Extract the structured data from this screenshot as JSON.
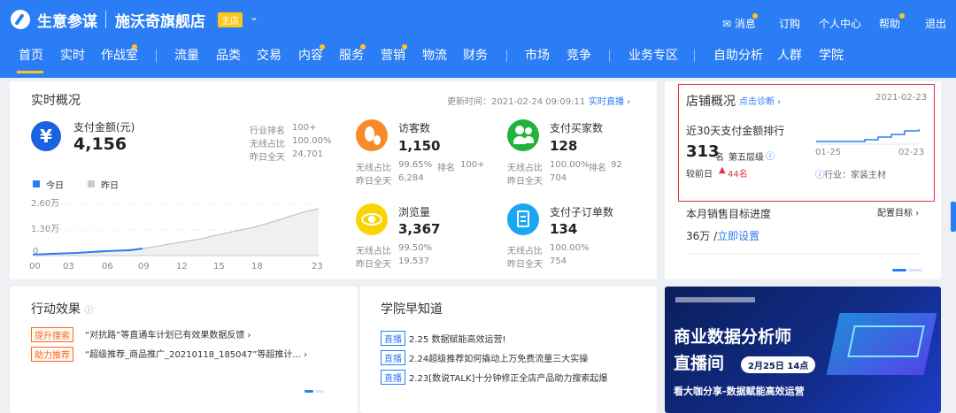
{
  "header": {
    "brand": "生意参谋",
    "shop_name": "施沃奇旗舰店",
    "shop_badge": "主店",
    "links": [
      "消息",
      "订购",
      "个人中心",
      "帮助",
      "退出"
    ]
  },
  "nav": [
    "首页",
    "实时",
    "作战室",
    "流量",
    "品类",
    "交易",
    "内容",
    "服务",
    "营销",
    "物流",
    "财务",
    "市场",
    "竞争",
    "业务专区",
    "自助分析",
    "人群",
    "学院"
  ],
  "realtime": {
    "title": "实时概况",
    "update_time": "更新时间：2021-02-24 09:09:11",
    "live_link": "实时直播",
    "pay": {
      "label": "支付金额(元)",
      "value": "4,156",
      "rank_label": "行业排名",
      "rank_value": "100+",
      "wireless_label": "无线占比",
      "wireless_value": "100.00%",
      "yesterday_label": "昨日全天",
      "yesterday_value": "24,701"
    },
    "legend_today": "今日",
    "legend_yesterday": "昨日",
    "y_ticks": [
      "2.60万",
      "1.30万",
      "0"
    ],
    "x_ticks": [
      "00",
      "03",
      "06",
      "09",
      "12",
      "15",
      "18",
      "23"
    ],
    "metrics": [
      {
        "label": "访客数",
        "value": "1,150",
        "wireless_label": "无线占比",
        "wireless": "99.65%",
        "yesterday_label": "昨日全天",
        "yesterday": "6,284",
        "extra_label": "排名",
        "extra": "100+",
        "icon": "footprint-icon",
        "color": "#f98a2b"
      },
      {
        "label": "支付买家数",
        "value": "128",
        "wireless_label": "无线占比",
        "wireless": "100.00%",
        "yesterday_label": "昨日全天",
        "yesterday": "704",
        "extra_label": "排名",
        "extra": "92",
        "icon": "buyers-icon",
        "color": "#22b43a"
      },
      {
        "label": "浏览量",
        "value": "3,367",
        "wireless_label": "无线占比",
        "wireless": "99.50%",
        "yesterday_label": "昨日全天",
        "yesterday": "19,537",
        "extra_label": "",
        "extra": "",
        "icon": "eye-icon",
        "color": "#fbd400"
      },
      {
        "label": "支付子订单数",
        "value": "134",
        "wireless_label": "无线占比",
        "wireless": "100.00%",
        "yesterday_label": "昨日全天",
        "yesterday": "754",
        "extra_label": "",
        "extra": "",
        "icon": "order-icon",
        "color": "#1aa5f5"
      }
    ]
  },
  "shop": {
    "title": "店铺概况",
    "diagnose": "点击诊断",
    "date": "2021-02-23",
    "rank_title": "近30天支付金额排行",
    "rank_value": "313",
    "rank_unit": "名",
    "level": "第五层级",
    "compare_label": "较前日",
    "compare_value": "44名",
    "chart_start": "01-25",
    "chart_end": "02-23",
    "industry": "行业：家装主材",
    "target_title": "本月销售目标进度",
    "target_config": "配置目标",
    "target_amount": "36万 /",
    "target_set": "立即设置"
  },
  "action": {
    "title": "行动效果",
    "items": [
      {
        "tag": "提升搜索",
        "text": "“对抗路”等直通车计划已有效果数据反馈"
      },
      {
        "tag": "助力推荐",
        "text": "“超级推荐_商品推广_20210118_185047”等超推计..."
      }
    ]
  },
  "academy": {
    "title": "学院早知道",
    "items": [
      {
        "tag": "直播",
        "text": "2.25 数据赋能高效运营!"
      },
      {
        "tag": "直播",
        "text": "2.24超级推荐如何撬动上万免费流量三大实操"
      },
      {
        "tag": "直播",
        "text": "2.23[数说TALK]十分钟修正全店产品助力搜索起爆"
      }
    ]
  },
  "banner": {
    "headline1": "商业数据分析师",
    "headline2": "直播间",
    "date_badge": "2月25日 14点",
    "footer": "看大咖分享-数据赋能高效运营"
  },
  "colors": {
    "primary": "#2b7df5",
    "badge": "#ffc61a",
    "highlight_border": "#e0343c"
  }
}
